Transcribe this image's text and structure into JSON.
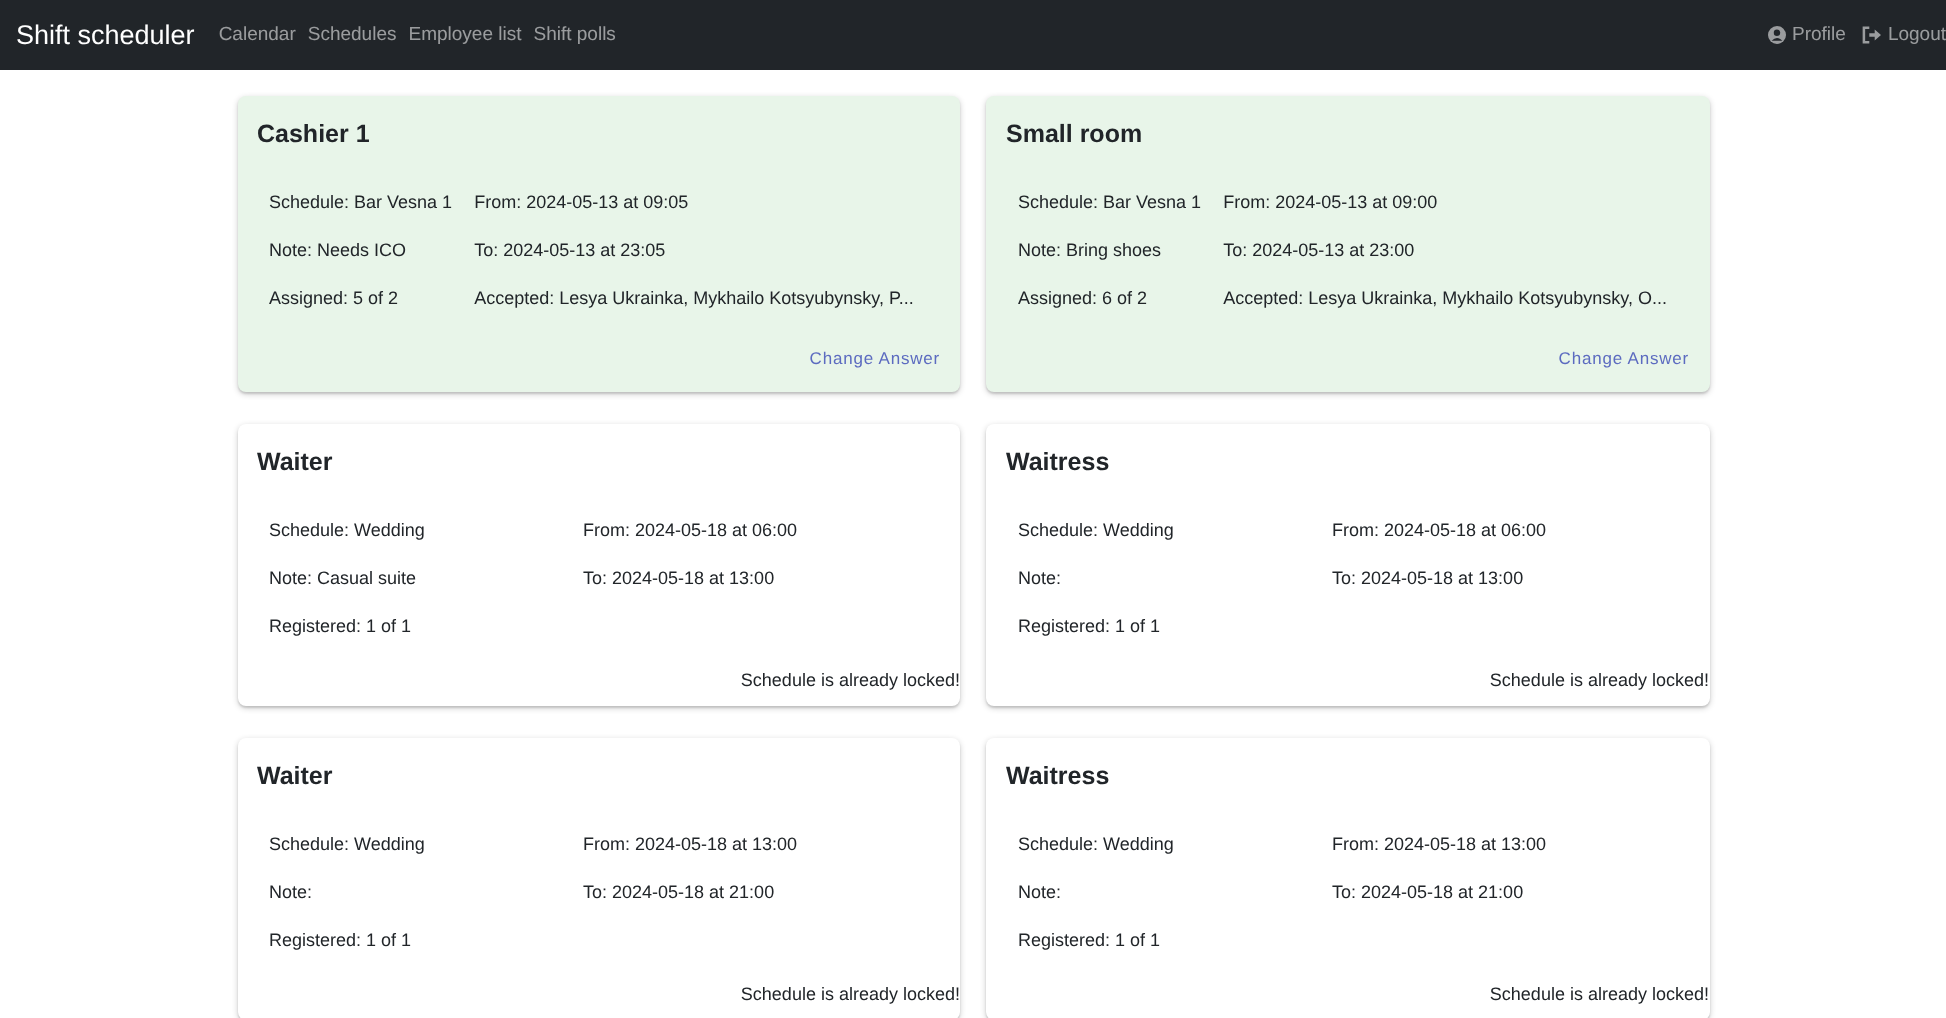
{
  "navbar": {
    "brand": "Shift scheduler",
    "links": [
      "Calendar",
      "Schedules",
      "Employee list",
      "Shift polls"
    ],
    "right_links": [
      {
        "kind": "profile",
        "label": "Profile"
      },
      {
        "kind": "logout",
        "label": "Logout"
      }
    ]
  },
  "cards": [
    {
      "kind": "answered",
      "title": "Cashier 1",
      "schedule": "Schedule: Bar Vesna 1",
      "note": "Note: Needs ICO",
      "count": "Assigned: 5 of 2",
      "from": "From: 2024-05-13 at 09:05",
      "to": "To: 2024-05-13 at 23:05",
      "accepted": "Accepted: Lesya Ukrainka, Mykhailo Kotsyubynsky, P...",
      "action": "Change Answer"
    },
    {
      "kind": "answered",
      "title": "Small room",
      "schedule": "Schedule: Bar Vesna 1",
      "note": "Note: Bring shoes",
      "count": "Assigned: 6 of 2",
      "from": "From: 2024-05-13 at 09:00",
      "to": "To: 2024-05-13 at 23:00",
      "accepted": "Accepted: Lesya Ukrainka, Mykhailo Kotsyubynsky, O...",
      "action": "Change Answer"
    },
    {
      "kind": "locked",
      "title": "Waiter",
      "schedule": "Schedule: Wedding",
      "note": "Note: Casual suite",
      "count": "Registered: 1 of 1",
      "from": "From: 2024-05-18 at 06:00",
      "to": "To: 2024-05-18 at 13:00",
      "action": "Schedule is already locked!"
    },
    {
      "kind": "locked",
      "title": "Waitress",
      "schedule": "Schedule: Wedding",
      "note": "Note:",
      "count": "Registered: 1 of 1",
      "from": "From: 2024-05-18 at 06:00",
      "to": "To: 2024-05-18 at 13:00",
      "action": "Schedule is already locked!"
    },
    {
      "kind": "locked",
      "title": "Waiter",
      "schedule": "Schedule: Wedding",
      "note": "Note:",
      "count": "Registered: 1 of 1",
      "from": "From: 2024-05-18 at 13:00",
      "to": "To: 2024-05-18 at 21:00",
      "action": "Schedule is already locked!"
    },
    {
      "kind": "locked",
      "title": "Waitress",
      "schedule": "Schedule: Wedding",
      "note": "Note:",
      "count": "Registered: 1 of 1",
      "from": "From: 2024-05-18 at 13:00",
      "to": "To: 2024-05-18 at 21:00",
      "action": "Schedule is already locked!"
    }
  ]
}
